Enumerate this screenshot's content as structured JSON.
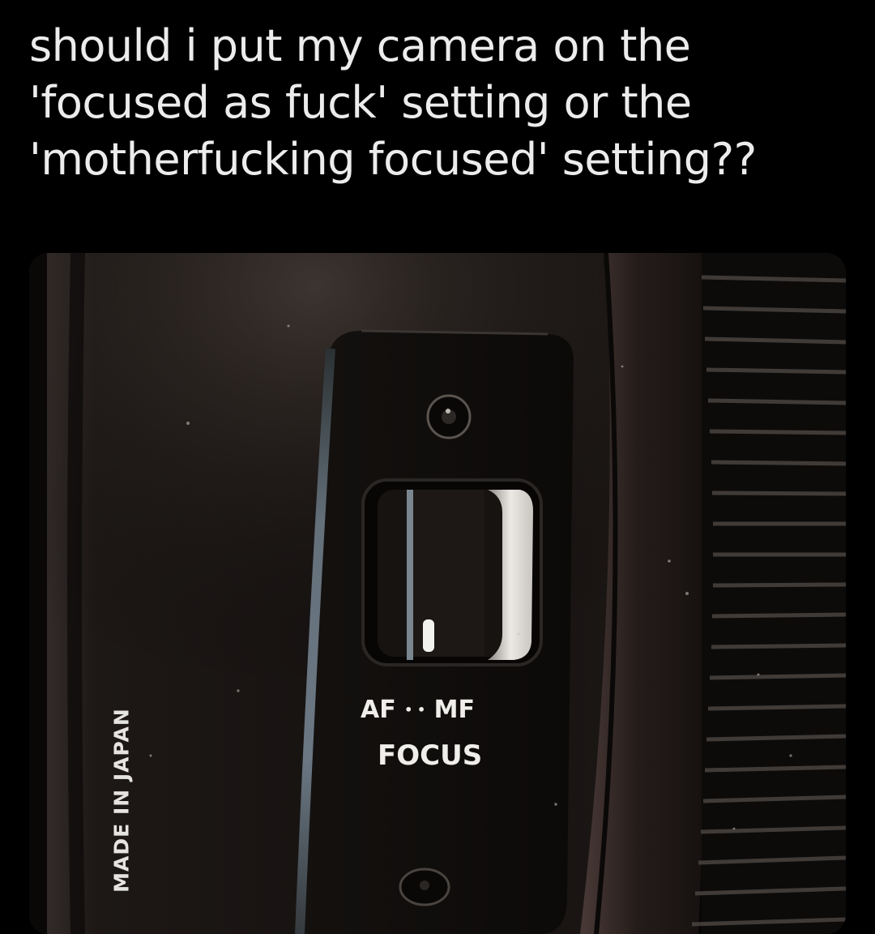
{
  "caption": {
    "line1": "should i put my camera on the",
    "line2": "'focused as fuck' setting or the",
    "line3": "'motherfucking focused' setting??"
  },
  "photo": {
    "lens_label": "MADE IN JAPAN",
    "switch_left": "AF",
    "switch_right": "MF",
    "switch_separator": "• •",
    "switch_name": "FOCUS"
  },
  "colors": {
    "background": "#000000",
    "caption_text": "#ececec",
    "lens_body": "#1a1513",
    "switch_highlight": "#e9e6e2"
  }
}
